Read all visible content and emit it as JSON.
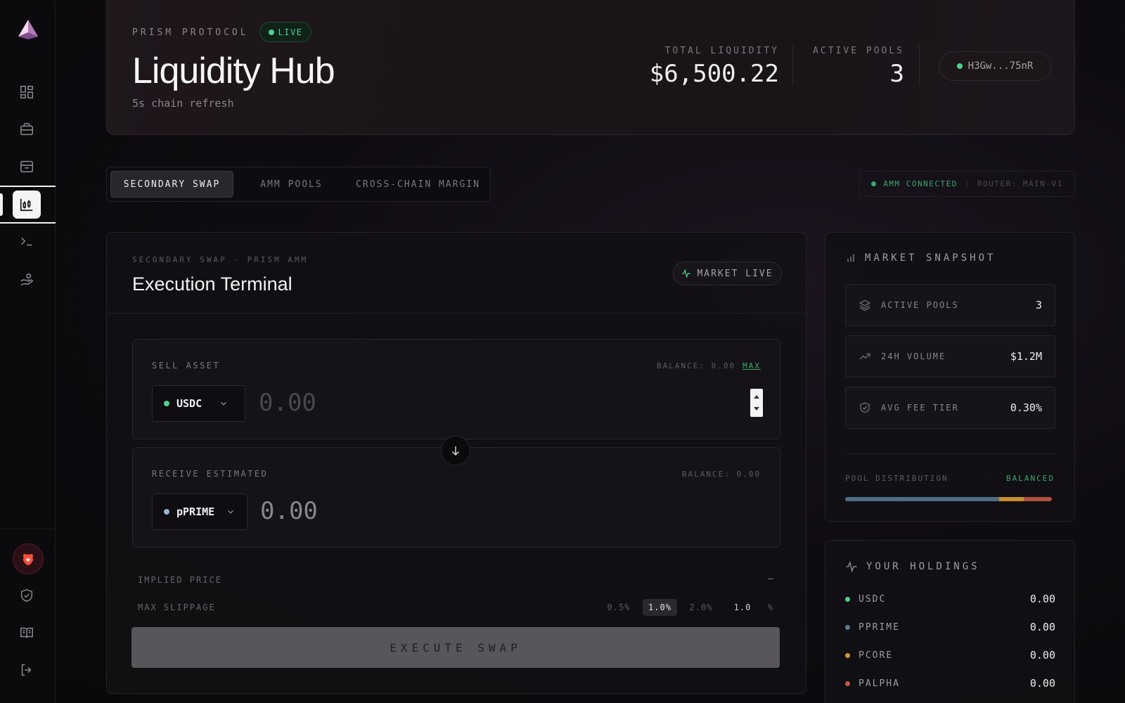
{
  "sidebar": {
    "icons": [
      "dashboard-icon",
      "briefcase-icon",
      "archive-icon",
      "chart-candles-icon",
      "terminal-icon",
      "hand-coins-icon"
    ],
    "bottom_icons": [
      "brave-lion-icon",
      "shield-check-icon",
      "book-icon",
      "logout-icon"
    ]
  },
  "header": {
    "brand": "PRISM PROTOCOL",
    "live_label": "LIVE",
    "title": "Liquidity Hub",
    "subtitle": "5s chain refresh",
    "total_liquidity_label": "TOTAL LIQUIDITY",
    "total_liquidity_value": "$6,500.22",
    "active_pools_label": "ACTIVE POOLS",
    "active_pools_value": "3",
    "wallet": "H3Gw...75nR"
  },
  "tabs": [
    {
      "label": "SECONDARY SWAP",
      "active": true
    },
    {
      "label": "AMM POOLS",
      "active": false
    },
    {
      "label": "CROSS-CHAIN MARGIN",
      "active": false
    }
  ],
  "connection": {
    "status": "AMM CONNECTED",
    "separator": "|",
    "router": "ROUTER: MAIN-V1"
  },
  "execution": {
    "crumb": "SECONDARY SWAP · PRISM AMM",
    "title": "Execution Terminal",
    "market_status": "MARKET LIVE",
    "sell": {
      "label": "SELL ASSET",
      "balance": "BALANCE: 0.00",
      "max": "MAX",
      "token": "USDC",
      "amount_placeholder": "0.00"
    },
    "receive": {
      "label": "RECEIVE ESTIMATED",
      "balance": "BALANCE: 0.00",
      "token": "pPRIME",
      "amount": "0.00"
    },
    "implied_price_label": "IMPLIED PRICE",
    "implied_price_value": "—",
    "max_slippage_label": "MAX SLIPPAGE",
    "slippage_options": [
      "0.5%",
      "1.0%",
      "2.0%"
    ],
    "slippage_custom": "1.0",
    "slippage_unit": "%",
    "execute_label": "EXECUTE SWAP"
  },
  "snapshot": {
    "title": "MARKET SNAPSHOT",
    "rows": [
      {
        "label": "ACTIVE POOLS",
        "value": "3"
      },
      {
        "label": "24H VOLUME",
        "value": "$1.2M"
      },
      {
        "label": "AVG FEE TIER",
        "value": "0.30%"
      }
    ],
    "distribution_label": "POOL DISTRIBUTION",
    "distribution_status": "BALANCED",
    "distribution": [
      {
        "share": 0.745,
        "color": "#4e6e86"
      },
      {
        "share": 0.12,
        "color": "#c7902f"
      },
      {
        "share": 0.135,
        "color": "#b0513c"
      }
    ]
  },
  "holdings": {
    "title": "YOUR HOLDINGS",
    "rows": [
      {
        "token": "USDC",
        "value": "0.00",
        "color": "#4fd18b"
      },
      {
        "token": "PPRIME",
        "value": "0.00",
        "color": "#5d7c96"
      },
      {
        "token": "PCORE",
        "value": "0.00",
        "color": "#d2953a"
      },
      {
        "token": "PALPHA",
        "value": "0.00",
        "color": "#c45a44"
      }
    ]
  },
  "colors": {
    "live_green": "#4fd18b",
    "accent_green": "#3aa86c"
  }
}
